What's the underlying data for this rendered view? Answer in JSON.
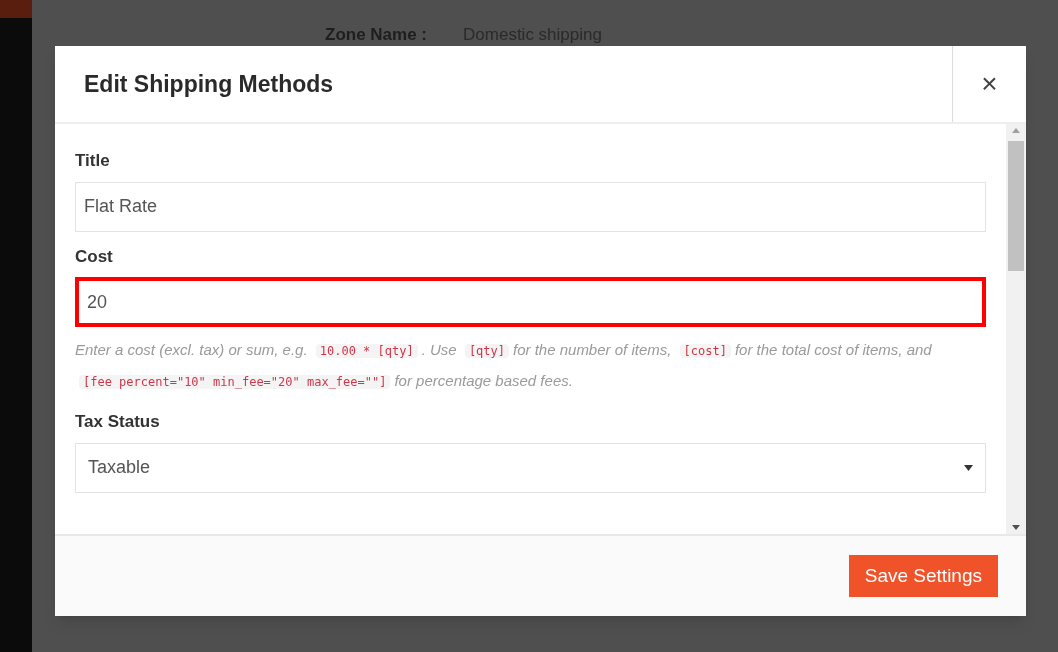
{
  "background": {
    "label": "Zone Name :",
    "value": "Domestic shipping"
  },
  "dialog": {
    "title": "Edit Shipping Methods",
    "close": "×"
  },
  "fields": [
    {
      "kind": "text",
      "label": "Title",
      "value": "Flat Rate",
      "highlighted": false
    },
    {
      "kind": "text",
      "label": "Cost",
      "value": "20",
      "highlighted": true,
      "help": [
        {
          "kind": "text",
          "text": "Enter a cost (excl. tax) or sum, e.g."
        },
        {
          "kind": "code",
          "text": "10.00 * [qty]"
        },
        {
          "kind": "text",
          "text": ". Use"
        },
        {
          "kind": "code",
          "text": "[qty]"
        },
        {
          "kind": "text",
          "text": "for the number of items,"
        },
        {
          "kind": "code",
          "text": "[cost]"
        },
        {
          "kind": "text",
          "text": "for the total cost of items, and"
        },
        {
          "kind": "code",
          "text": "[fee percent=\"10\" min_fee=\"20\" max_fee=\"\"]"
        },
        {
          "kind": "text",
          "text": "for percentage based fees."
        }
      ]
    },
    {
      "kind": "select",
      "label": "Tax Status",
      "value": "Taxable",
      "highlighted": false
    }
  ],
  "save_button": "Save Settings"
}
